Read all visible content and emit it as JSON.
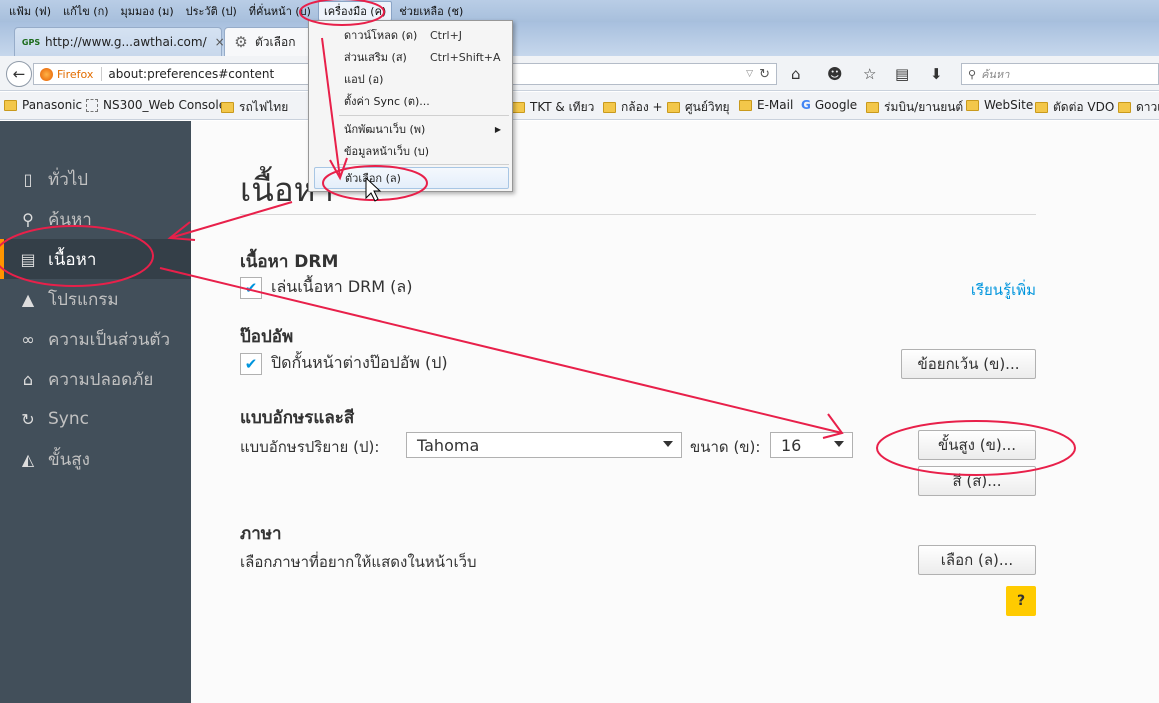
{
  "menubar": {
    "items": [
      {
        "label": "แฟ้ม (ฟ)"
      },
      {
        "label": "แก้ไข (ก)"
      },
      {
        "label": "มุมมอง (ม)"
      },
      {
        "label": "ประวัติ (ป)"
      },
      {
        "label": "ที่คั่นหน้า (บ)"
      },
      {
        "label": "เครื่องมือ (ค)"
      },
      {
        "label": "ช่วยเหลือ (ช)"
      }
    ]
  },
  "tabs": [
    {
      "icon": "GPS",
      "title": "http://www.g...awthai.com/",
      "close": "×"
    },
    {
      "title": "ตัวเลือก"
    }
  ],
  "navbar": {
    "identity": "Firefox",
    "url": "about:preferences#content",
    "search_placeholder": "ค้นหา"
  },
  "bookmarks": [
    {
      "label": "Panasonic"
    },
    {
      "label": "NS300_Web Console"
    },
    {
      "label": "รถไฟไทย"
    },
    {
      "label": "TKT & เทียว"
    },
    {
      "label": "กล้อง +"
    },
    {
      "label": "ศูนย์วิทยุ"
    },
    {
      "label": "E-Mail"
    },
    {
      "label": "Google"
    },
    {
      "label": "ร่มบิน/ยานยนต์"
    },
    {
      "label": "WebSite"
    },
    {
      "label": "ตัดต่อ VDO"
    },
    {
      "label": "ดาวเ"
    }
  ],
  "sidebar": {
    "items": [
      {
        "label": "ทั่วไป"
      },
      {
        "label": "ค้นหา"
      },
      {
        "label": "เนื้อหา"
      },
      {
        "label": "โปรแกรม"
      },
      {
        "label": "ความเป็นส่วนตัว"
      },
      {
        "label": "ความปลอดภัย"
      },
      {
        "label": "Sync"
      },
      {
        "label": "ขั้นสูง"
      }
    ],
    "selected": "เนื้อหา"
  },
  "content": {
    "title": "เนื้อหา",
    "drm": {
      "heading": "เนื้อหา DRM",
      "checkbox_label": "เล่นเนื้อหา DRM (ล)",
      "learn_more": "เรียนรู้เพิ่ม"
    },
    "popups": {
      "heading": "ป๊อปอัพ",
      "checkbox_label": "ปิดกั้นหน้าต่างป๊อปอัพ (ป)",
      "exceptions_button": "ข้อยกเว้น (ข)..."
    },
    "fonts": {
      "heading": "แบบอักษรและสี",
      "default_font_label": "แบบอักษรปริยาย (ป):",
      "default_font_value": "Tahoma",
      "size_label": "ขนาด (ข):",
      "size_value": "16",
      "advanced_button": "ขั้นสูง (ข)...",
      "colors_button": "สี (ส)..."
    },
    "languages": {
      "heading": "ภาษา",
      "description": "เลือกภาษาที่อยากให้แสดงในหน้าเว็บ",
      "choose_button": "เลือก (ล)..."
    },
    "help": "?"
  },
  "tools_menu": {
    "items": [
      {
        "label": "ดาวน์โหลด (ด)",
        "shortcut": "Ctrl+J"
      },
      {
        "label": "ส่วนเสริม (ส)",
        "shortcut": "Ctrl+Shift+A"
      },
      {
        "label": "แอป (อ)"
      },
      {
        "label": "ตั้งค่า Sync (ต)..."
      },
      {
        "label": "นักพัฒนาเว็บ (พ)"
      },
      {
        "label": "ข้อมูลหน้าเว็บ (บ)"
      },
      {
        "label": "ตัวเลือก (ล)"
      }
    ],
    "highlighted": "ตัวเลือก (ล)"
  },
  "colors": {
    "sidebar_bg": "#424f5a",
    "sidebar_selected": "#343f48",
    "accent_link": "#0095dd",
    "annotation": "#e8204a",
    "help_button": "#ffcb00"
  }
}
